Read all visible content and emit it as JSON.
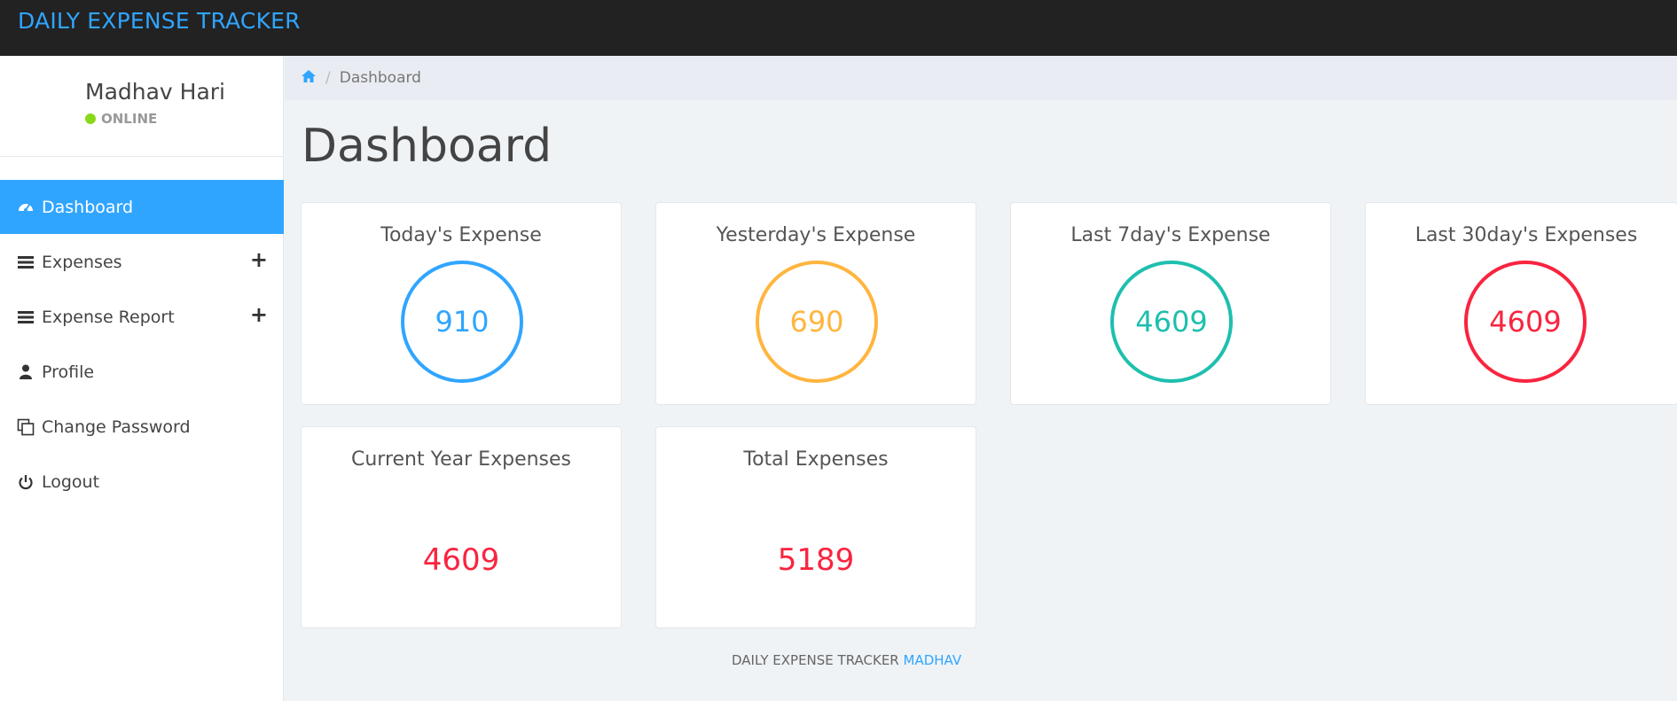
{
  "app": {
    "brand": "DAILY EXPENSE TRACKER"
  },
  "user": {
    "name": "Madhav Hari",
    "status": "ONLINE"
  },
  "sidebar": {
    "items": [
      {
        "label": "Dashboard",
        "icon": "dashboard-icon",
        "active": true
      },
      {
        "label": "Expenses",
        "icon": "list-icon",
        "expandable": true
      },
      {
        "label": "Expense Report",
        "icon": "list-icon",
        "expandable": true
      },
      {
        "label": "Profile",
        "icon": "user-icon"
      },
      {
        "label": "Change Password",
        "icon": "copy-icon"
      },
      {
        "label": "Logout",
        "icon": "power-icon"
      }
    ]
  },
  "breadcrumb": {
    "home_icon": "home-icon",
    "current": "Dashboard"
  },
  "page": {
    "title": "Dashboard"
  },
  "cards": [
    {
      "title": "Today's Expense",
      "value": "910",
      "color": "#30a5ff"
    },
    {
      "title": "Yesterday's Expense",
      "value": "690",
      "color": "#ffb53e"
    },
    {
      "title": "Last 7day's Expense",
      "value": "4609",
      "color": "#1ebfae"
    },
    {
      "title": "Last 30day's Expenses",
      "value": "4609",
      "color": "#f9243f"
    },
    {
      "title": "Current Year Expenses",
      "value": "4609",
      "color": "#f9243f"
    },
    {
      "title": "Total Expenses",
      "value": "5189",
      "color": "#f9243f"
    }
  ],
  "footer": {
    "text": "DAILY EXPENSE TRACKER",
    "link": "MADHAV"
  },
  "colors": {
    "accent": "#30a5ff",
    "topbar": "#222222",
    "online": "#8ad919"
  }
}
